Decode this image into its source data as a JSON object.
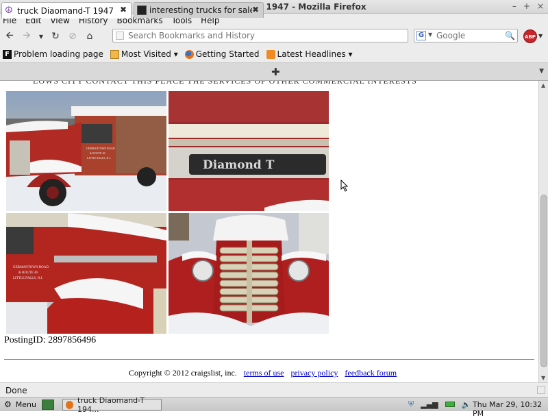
{
  "window": {
    "title": "truck Diaomand-T 1947 - Mozilla Firefox",
    "controls": [
      "–",
      "+",
      "×"
    ]
  },
  "menu": [
    "File",
    "Edit",
    "View",
    "History",
    "Bookmarks",
    "Tools",
    "Help"
  ],
  "nav": {
    "url_placeholder": "Search Bookmarks and History",
    "search_placeholder": "Google",
    "search_engine": "G",
    "abp": "ABP"
  },
  "bookmarks": [
    "Problem loading page",
    "Most Visited ▾",
    "Getting Started",
    "Latest Headlines ▾"
  ],
  "tabs": [
    {
      "label": "truck Diaomand-T 1947"
    },
    {
      "label": "interesting trucks for sale t..."
    }
  ],
  "page": {
    "cut_text": "LOWS CITY CONTACT THIS PLACE THE SERVICES OF OTHER COMMERCIAL INTERESTS",
    "photos": [
      {
        "alt": "red truck in snow side view"
      },
      {
        "alt": "Diamond T grille badge"
      },
      {
        "alt": "truck cab door"
      },
      {
        "alt": "truck front grille with headlights"
      }
    ],
    "grille_text": "Diamond T",
    "door_text": [
      "GERMANTOWN ROAD",
      "& ROUTE 46",
      "LITTLE FALLS, N.J."
    ],
    "posting_label": "PostingID: 2897856496",
    "copyright": "Copyright © 2012 craigslist, inc.",
    "links": [
      "terms of use",
      "privacy policy",
      "feedback forum"
    ]
  },
  "status": "Done",
  "taskbar": {
    "menu": "Menu",
    "task": "truck Diaomand-T 194...",
    "clock": "Thu Mar 29, 10:32 PM"
  }
}
